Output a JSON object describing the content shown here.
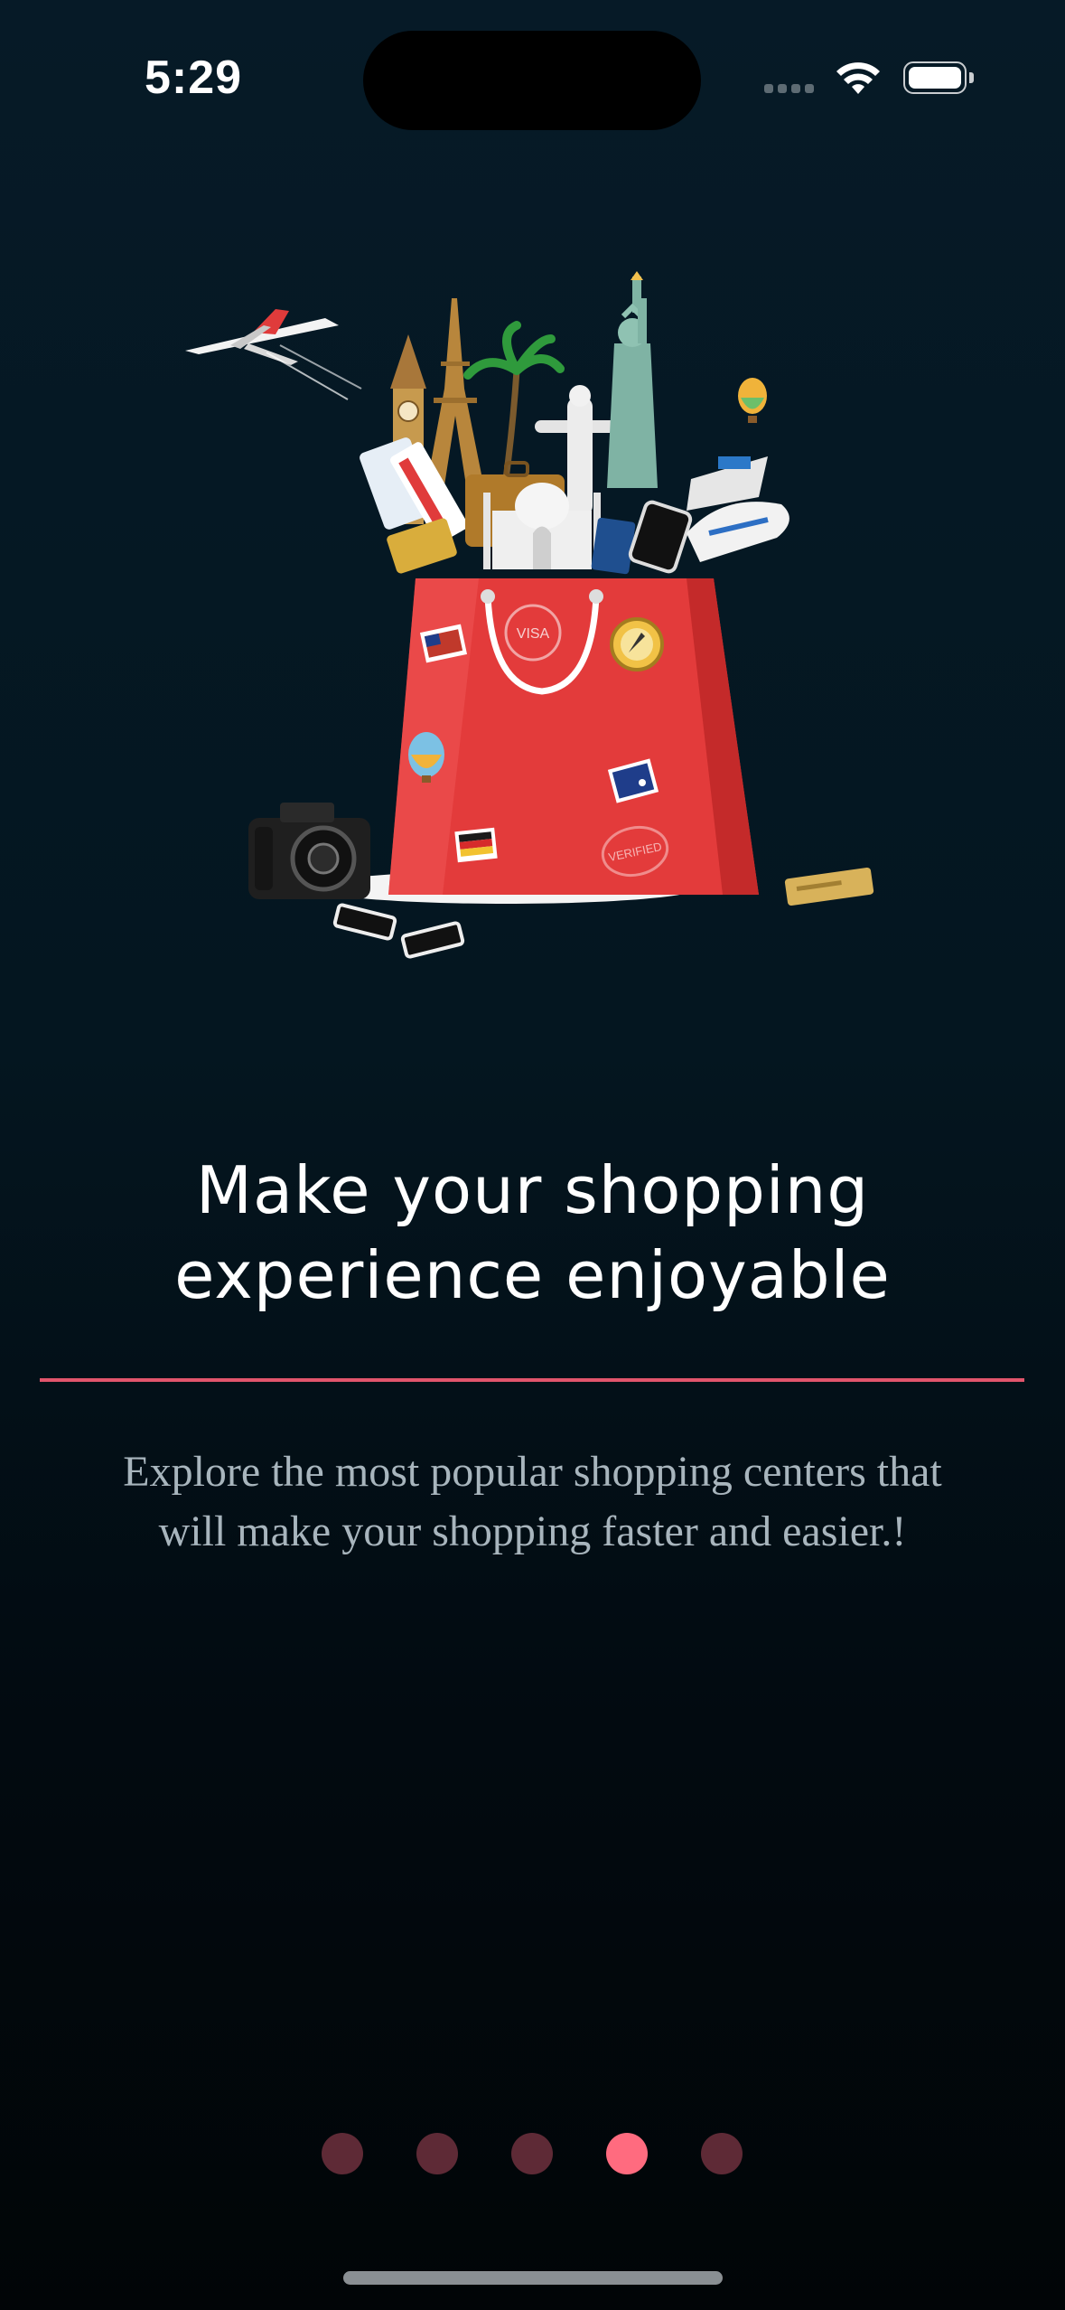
{
  "status_bar": {
    "time": "5:29"
  },
  "illustration": {
    "description_icon": "shopping-bag-travel-icon",
    "sticker_text_visa": "VISA",
    "sticker_text_verified": "VERIFIED"
  },
  "onboarding": {
    "headline_line1": "Make your shopping",
    "headline_line2": "experience enjoyable",
    "description_line1": "Explore the most popular shopping centers that",
    "description_line2": "will make your shopping faster and easier.!"
  },
  "pager": {
    "total_pages": 5,
    "active_index": 3,
    "active_color": "#ff6b7f",
    "inactive_color": "#5e2a36"
  },
  "colors": {
    "accent": "#e2556c",
    "background": "#041620",
    "bag_red": "#e33b3b"
  }
}
